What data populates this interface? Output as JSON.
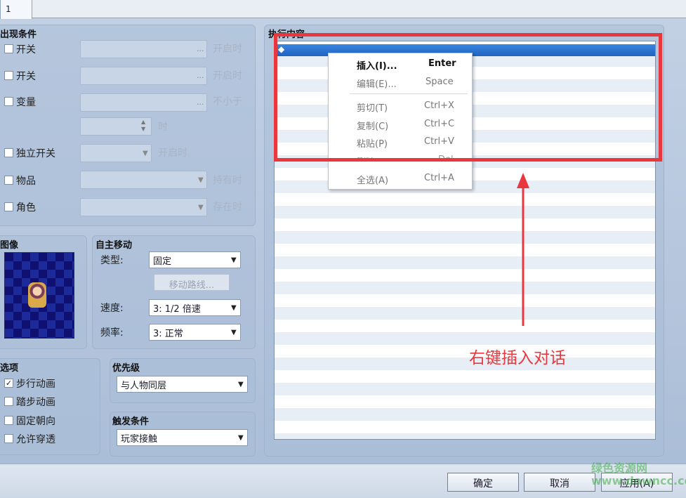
{
  "tabs": [
    "1"
  ],
  "conditions": {
    "title": "出现条件",
    "rows": [
      {
        "label": "开关",
        "ellipsis": "...",
        "suffix": "开启时"
      },
      {
        "label": "开关",
        "ellipsis": "...",
        "suffix": "开启时"
      },
      {
        "label": "变量",
        "ellipsis": "...",
        "suffix": "不小于"
      },
      {
        "label": "",
        "suffix": "时"
      },
      {
        "label": "独立开关",
        "suffix": "开启时"
      },
      {
        "label": "物品",
        "suffix": "持有时"
      },
      {
        "label": "角色",
        "suffix": "存在时"
      }
    ]
  },
  "image": {
    "title": "图像"
  },
  "autonomous": {
    "title": "自主移动",
    "type_label": "类型:",
    "type_value": "固定",
    "route_button": "移动路线...",
    "speed_label": "速度:",
    "speed_value": "3: 1/2 倍速",
    "freq_label": "频率:",
    "freq_value": "3: 正常"
  },
  "options": {
    "title": "选项",
    "items": [
      {
        "label": "步行动画",
        "checked": true
      },
      {
        "label": "踏步动画",
        "checked": false
      },
      {
        "label": "固定朝向",
        "checked": false
      },
      {
        "label": "允许穿透",
        "checked": false
      }
    ]
  },
  "priority": {
    "title": "优先级",
    "value": "与人物同层"
  },
  "trigger": {
    "title": "触发条件",
    "value": "玩家接触"
  },
  "contents": {
    "title": "执行内容",
    "first_item": "◆"
  },
  "context_menu": {
    "items": [
      {
        "label": "插入(I)...",
        "shortcut": "Enter",
        "enabled": true
      },
      {
        "label": "编辑(E)...",
        "shortcut": "Space",
        "enabled": false
      },
      {
        "label": "剪切(T)",
        "shortcut": "Ctrl+X",
        "enabled": false
      },
      {
        "label": "复制(C)",
        "shortcut": "Ctrl+C",
        "enabled": false
      },
      {
        "label": "粘贴(P)",
        "shortcut": "Ctrl+V",
        "enabled": false
      },
      {
        "label": "删除(D)",
        "shortcut": "Del",
        "enabled": false
      },
      {
        "label": "全选(A)",
        "shortcut": "Ctrl+A",
        "enabled": false
      }
    ]
  },
  "annotation": {
    "text": "右键插入对话",
    "color": "#e8383d"
  },
  "buttons": {
    "ok": "确定",
    "cancel": "取消",
    "apply": "应用(A)"
  },
  "watermark": "绿色资源网 www.downcc.com",
  "colors": {
    "selection": "#1e6fd0",
    "highlight_box": "#e8383d"
  }
}
